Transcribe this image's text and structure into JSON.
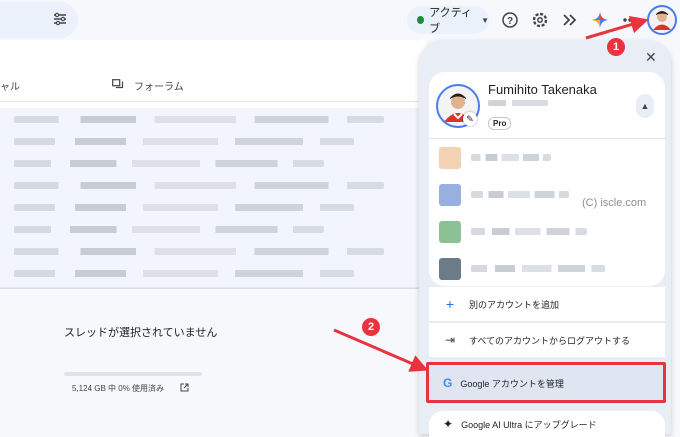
{
  "topbar": {
    "status_label": "アクティブ"
  },
  "mail": {
    "tab_social_partial": "ャル",
    "tab_forums": "フォーラム",
    "rows": [
      1,
      2,
      3,
      4,
      5,
      6,
      7,
      8
    ],
    "empty_text": "スレッドが選択されていません",
    "storage_text": "5,124 GB 中 0% 使用済み",
    "storage_percent": 0
  },
  "account_panel": {
    "name": "Fumihito Takenaka",
    "plan_badge": "Pro",
    "other_accounts": [
      {
        "color": "#f4c7a1"
      },
      {
        "color": "#7e9cd8"
      },
      {
        "color": "#6fb27a"
      },
      {
        "color": "#465a6a"
      }
    ],
    "add_account": "別のアカウントを追加",
    "sign_out_all": "すべてのアカウントからログアウトする",
    "manage_account": "Google アカウントを管理",
    "upgrade": "Google AI Ultra にアップグレード"
  },
  "annotations": {
    "step1": "1",
    "step2": "2"
  },
  "watermark": "(C) iscle.com",
  "colors": {
    "accent_red": "#e8343f",
    "active_green": "#1e8e3e"
  }
}
